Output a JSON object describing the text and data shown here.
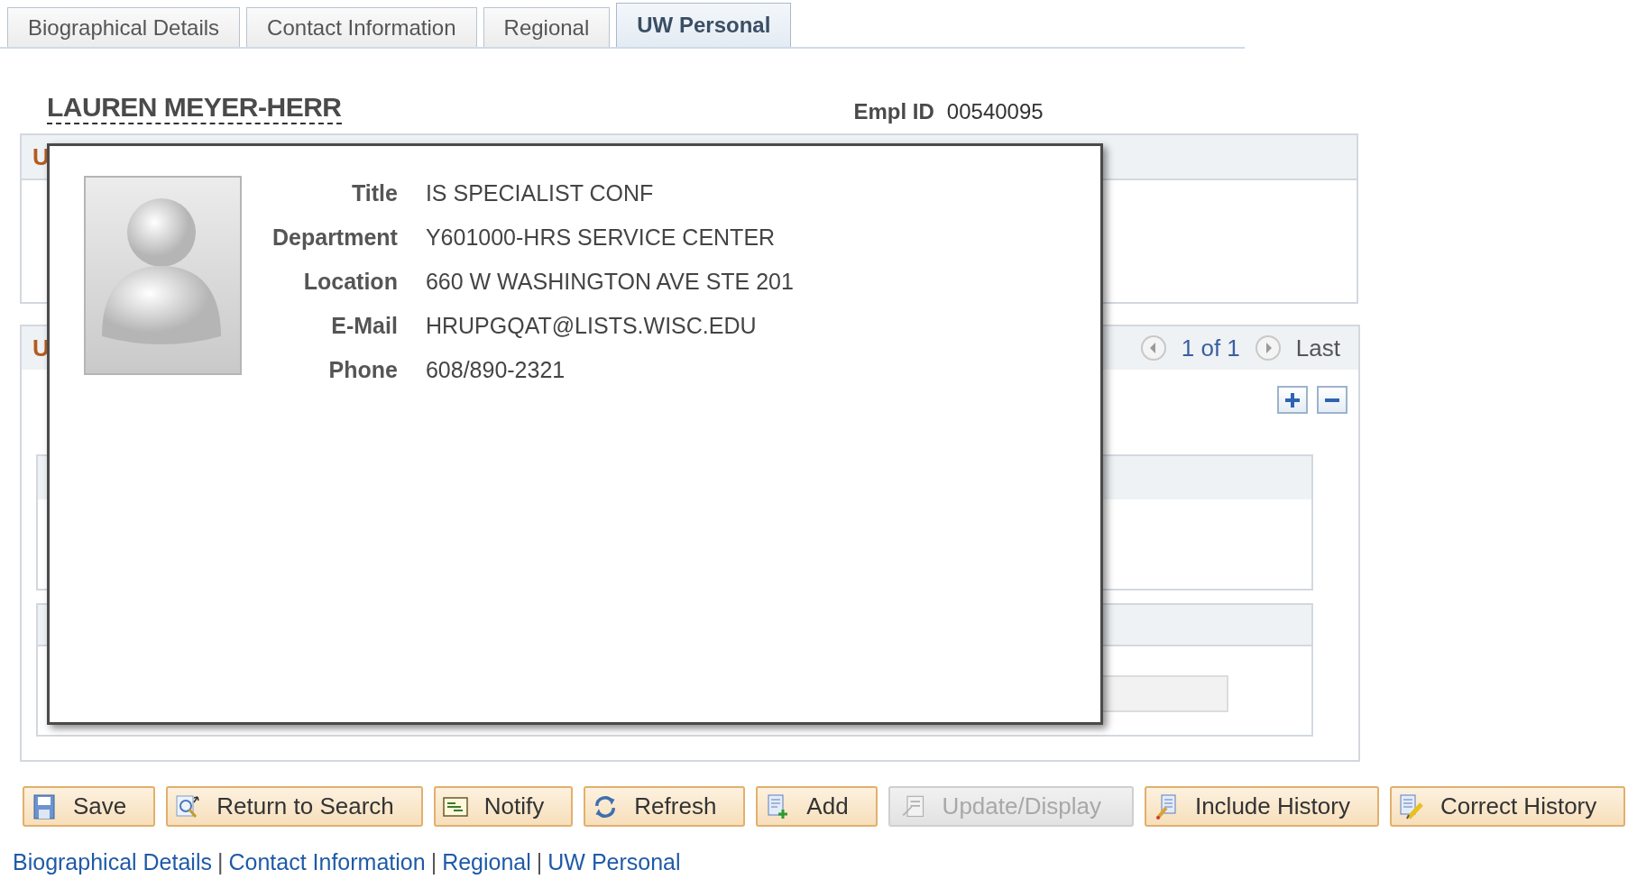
{
  "tabs": [
    {
      "label": "Biographical Details",
      "selected": false
    },
    {
      "label": "Contact Information",
      "selected": false
    },
    {
      "label": "Regional",
      "selected": false
    },
    {
      "label": "UW Personal",
      "selected": true
    }
  ],
  "employee": {
    "name": "LAUREN MEYER-HERR",
    "empl_id_label": "Empl ID",
    "empl_id": "00540095"
  },
  "sections": [
    {
      "title": "U"
    },
    {
      "title": "U",
      "pager": {
        "position": "1 of 1",
        "last": "Last"
      }
    }
  ],
  "popup": {
    "fields": [
      {
        "label": "Title",
        "value": "IS SPECIALIST CONF"
      },
      {
        "label": "Department",
        "value": "Y601000-HRS SERVICE CENTER"
      },
      {
        "label": "Location",
        "value": "660 W WASHINGTON AVE STE 201"
      },
      {
        "label": "E-Mail",
        "value": "HRUPGQAT@LISTS.WISC.EDU"
      },
      {
        "label": "Phone",
        "value": "608/890-2321"
      }
    ]
  },
  "toolbar": [
    {
      "label": "Save",
      "kind": "save",
      "disabled": false
    },
    {
      "label": "Return to Search",
      "kind": "search",
      "disabled": false
    },
    {
      "label": "Notify",
      "kind": "notify",
      "disabled": false
    },
    {
      "label": "Refresh",
      "kind": "refresh",
      "disabled": false
    },
    {
      "label": "Add",
      "kind": "add",
      "disabled": false
    },
    {
      "label": "Update/Display",
      "kind": "update",
      "disabled": true
    },
    {
      "label": "Include History",
      "kind": "include",
      "disabled": false
    },
    {
      "label": "Correct History",
      "kind": "correct",
      "disabled": false
    }
  ],
  "footer_links": {
    "separator": "|",
    "links": [
      "Biographical Details",
      "Contact Information",
      "Regional",
      "UW Personal"
    ]
  }
}
